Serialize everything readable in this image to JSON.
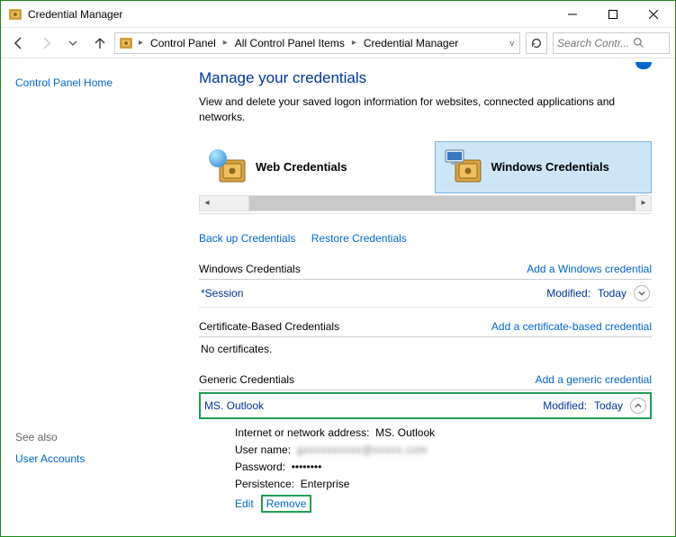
{
  "window": {
    "title": "Credential Manager"
  },
  "breadcrumbs": {
    "a": "Control Panel",
    "b": "All Control Panel Items",
    "c": "Credential Manager"
  },
  "search": {
    "placeholder": "Search Contr...",
    "icon": "search"
  },
  "sidebar": {
    "home": "Control Panel Home",
    "see_also_label": "See also",
    "user_accounts": "User Accounts"
  },
  "main": {
    "heading": "Manage your credentials",
    "sub": "View and delete your saved logon information for websites, connected applications and networks."
  },
  "categories": {
    "web": "Web Credentials",
    "windows": "Windows Credentials"
  },
  "links": {
    "backup": "Back up Credentials",
    "restore": "Restore Credentials"
  },
  "sections": {
    "win": {
      "title": "Windows Credentials",
      "add": "Add a Windows credential",
      "entry_name": "*Session",
      "mod_label": "Modified:",
      "mod_val": "Today"
    },
    "cert": {
      "title": "Certificate-Based Credentials",
      "add": "Add a certificate-based credential",
      "empty": "No certificates."
    },
    "gen": {
      "title": "Generic Credentials",
      "add": "Add a generic credential",
      "entry_name": "MS. Outlook",
      "mod_label": "Modified:",
      "mod_val": "Today"
    }
  },
  "details": {
    "addr_label": "Internet or network address:",
    "addr_val": "MS. Outlook",
    "user_label": "User name:",
    "user_val": "gxxxxxxxxxx@xxxxx.com",
    "pass_label": "Password:",
    "pass_val": "••••••••",
    "persist_label": "Persistence:",
    "persist_val": "Enterprise",
    "edit": "Edit",
    "remove": "Remove"
  }
}
